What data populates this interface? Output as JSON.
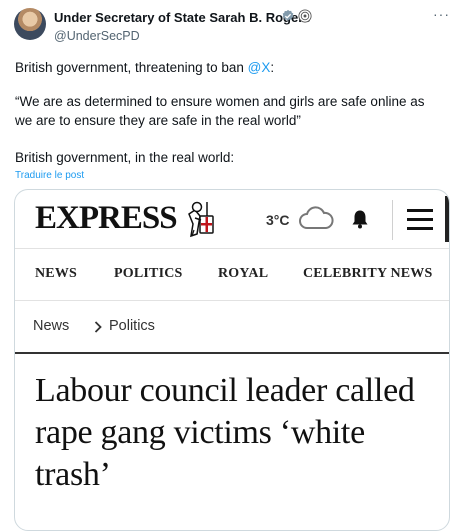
{
  "author": {
    "name": "Under Secretary of State Sarah B. Rogers",
    "handle": "@UnderSecPD",
    "verified_icon": "verified-badge-icon",
    "affiliation_icon": "government-seal-icon"
  },
  "more_icon": "more-options-icon",
  "tweet": {
    "line1_prefix": "British government, threatening to ban ",
    "line1_mention": "@X",
    "line1_suffix": ":",
    "quote": "“We are as determined to ensure women and girls are safe online as we are to ensure they are safe in the real world”",
    "line3": "British government, in the real world:",
    "translate": "Traduire le post"
  },
  "article": {
    "logo": "EXPRESS",
    "weather": {
      "temp": "3°C",
      "icon": "cloud-icon"
    },
    "nav": [
      "NEWS",
      "POLITICS",
      "ROYAL",
      "CELEBRITY NEWS"
    ],
    "breadcrumb": [
      "News",
      "Politics"
    ],
    "headline": "Labour council leader called rape gang victims ‘white trash’"
  },
  "colors": {
    "link": "#1d9bf0",
    "muted": "#536471",
    "text": "#0f1419"
  }
}
